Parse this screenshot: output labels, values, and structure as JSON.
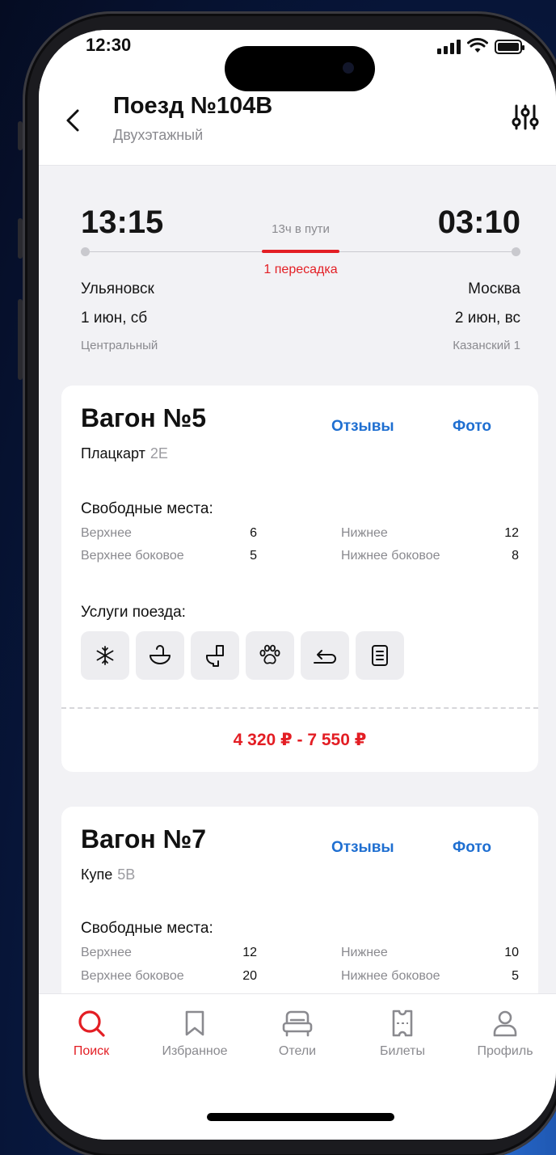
{
  "status_bar": {
    "time": "12:30"
  },
  "header": {
    "title": "Поезд №104В",
    "subtitle": "Двухэтажный"
  },
  "route": {
    "departure": {
      "time": "13:15",
      "city": "Ульяновск",
      "date": "1 июн, сб",
      "station": "Центральный"
    },
    "arrival": {
      "time": "03:10",
      "city": "Москва",
      "date": "2 июн, вс",
      "station": "Казанский 1"
    },
    "duration": "13ч в пути",
    "transfers": "1 пересадка"
  },
  "cars": [
    {
      "title": "Вагон №5",
      "type": "Плацкарт",
      "code": "2Е",
      "reviews_label": "Отзывы",
      "photo_label": "Фото",
      "seats_title": "Свободные места:",
      "seats": [
        {
          "label": "Верхнее",
          "count": "6"
        },
        {
          "label": "Нижнее",
          "count": "12"
        },
        {
          "label": "Верхнее боковое",
          "count": "5"
        },
        {
          "label": "Нижнее боковое",
          "count": "8"
        }
      ],
      "services_title": "Услуги поезда:",
      "services": [
        "snowflake-icon",
        "washbasin-icon",
        "toilet-icon",
        "paw-icon",
        "return-icon",
        "document-icon"
      ],
      "price": "4 320 ₽ - 7 550 ₽"
    },
    {
      "title": "Вагон №7",
      "type": "Купе",
      "code": "5В",
      "reviews_label": "Отзывы",
      "photo_label": "Фото",
      "seats_title": "Свободные места:",
      "seats": [
        {
          "label": "Верхнее",
          "count": "12"
        },
        {
          "label": "Нижнее",
          "count": "10"
        },
        {
          "label": "Верхнее боковое",
          "count": "20"
        },
        {
          "label": "Нижнее боковое",
          "count": "5"
        }
      ]
    }
  ],
  "tabbar": {
    "active": "Поиск",
    "tabs": [
      {
        "label": "Поиск",
        "icon": "search-icon"
      },
      {
        "label": "Избранное",
        "icon": "bookmark-icon"
      },
      {
        "label": "Отели",
        "icon": "bed-icon"
      },
      {
        "label": "Билеты",
        "icon": "ticket-icon"
      },
      {
        "label": "Профиль",
        "icon": "profile-icon"
      }
    ]
  },
  "colors": {
    "accent_red": "#e31e24",
    "link_blue": "#1f6fd1",
    "background": "#f2f2f5"
  }
}
